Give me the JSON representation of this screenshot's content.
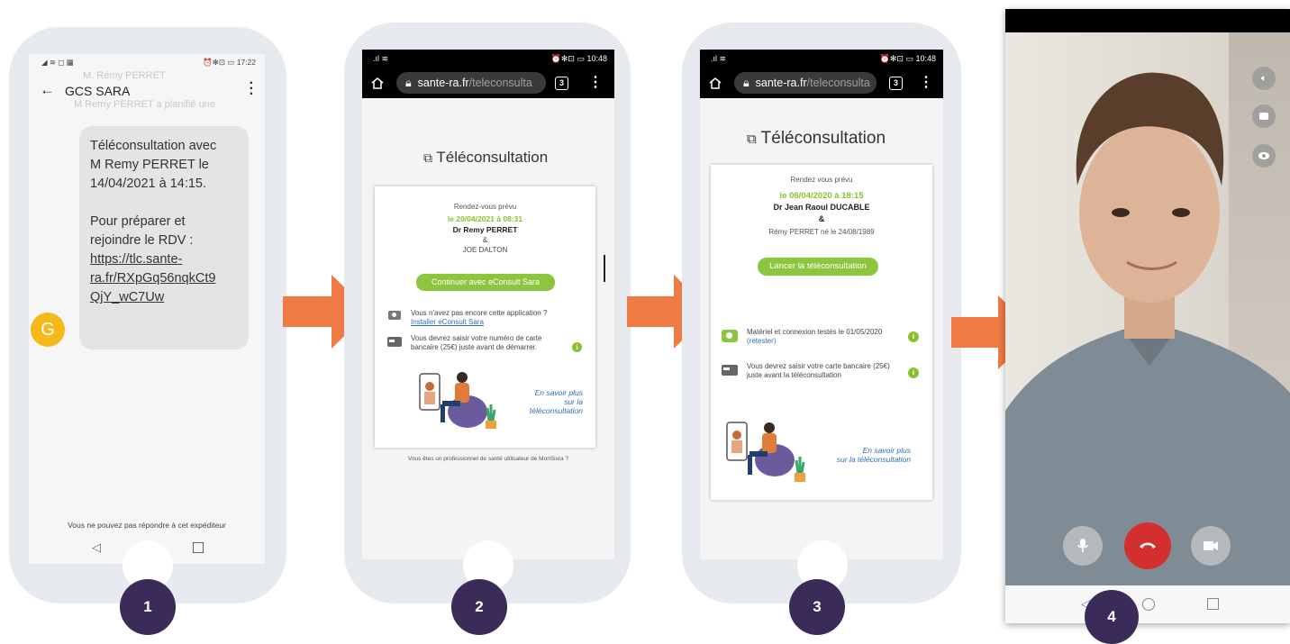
{
  "steps": [
    "1",
    "2",
    "3",
    "4"
  ],
  "colors": {
    "accent_green": "#8cc63f",
    "step_badge": "#3a2b58",
    "arrow": "#ef7a44",
    "hangup": "#d32f2f"
  },
  "phone1": {
    "status_time": "17:22",
    "status_icons": "⏰✻⊡ ▭",
    "header_title": "GCS SARA",
    "ghost_line1": "M. Rémy PERRET",
    "ghost_line2": "M Remy PERRET a planifié une",
    "message_lines": [
      "Téléconsultation avec",
      "M Remy PERRET le",
      "14/04/2021 à 14:15.",
      "",
      "Pour préparer et",
      "rejoindre le RDV :"
    ],
    "message_link_lines": [
      "https://tlc.sante-",
      "ra.fr/RXpGq56nqkCt9",
      "QjY_wC7Uw"
    ],
    "avatar_letter": "G",
    "footer_note": "Vous ne pouvez pas répondre à cet expéditeur",
    "nav_icons": [
      "back-triangle",
      "home-circle",
      "recent-square"
    ]
  },
  "phone2": {
    "status_time": "10:48",
    "url_host": "sante-ra.fr",
    "url_path": "/teleconsulta",
    "tab_count": "3",
    "title": "Téléconsultation",
    "appt_label": "Rendez-vous prévu",
    "appt_datetime": "le 20/04/2021 à 08:31",
    "doctor": "Dr Remy PERRET",
    "ampersand": "&",
    "patient": "JOE DALTON",
    "button_label": "Continuer avec eConsult Sara",
    "install_prompt": "Vous n'avez pas encore cette application ?",
    "install_link": "Installer eConsult Sara",
    "card_notice_line1": "Vous devrez saisir votre numéro de carte",
    "card_notice_line2": "bancaire (25€) juste avant de démarrer.",
    "learn_more_1": "En savoir plus",
    "learn_more_2": "sur la",
    "learn_more_3": "téléconsultation",
    "pro_note": "Vous êtes un professionnel de santé utilisateur de MonSisra ?"
  },
  "phone3": {
    "status_time": "10:48",
    "url_host": "sante-ra.fr",
    "url_path": "/teleconsulta",
    "tab_count": "3",
    "title": "Téléconsultation",
    "appt_label": "Rendez vous prévu",
    "appt_datetime": "le 06/04/2020 à 18:15",
    "doctor": "Dr Jean Raoul DUCABLE",
    "ampersand": "&",
    "patient": "Rémy PERRET né le 24/08/1989",
    "button_label": "Lancer la téléconsultation",
    "tested_line1": "Matériel et connexion testés le 01/05/2020",
    "tested_link": "(retester)",
    "card_notice_line1": "Vous devrez saisir votre carte bancaire (25€)",
    "card_notice_line2": "juste avant la téléconsultation",
    "learn_more_1": "En savoir plus",
    "learn_more_2": "sur la téléconsultation"
  },
  "phone4": {
    "side_icons": [
      "speaker-icon",
      "screen-share-icon",
      "eye-icon"
    ],
    "call_controls": [
      "mic-icon",
      "hangup-icon",
      "camera-icon"
    ]
  }
}
